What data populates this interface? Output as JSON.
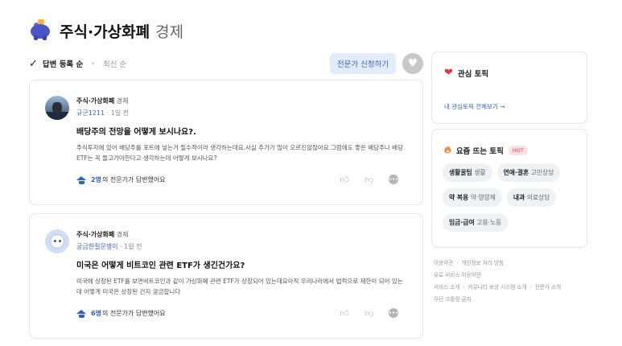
{
  "header": {
    "title_main": "주식·가상화폐",
    "title_sub": "경제",
    "icon": "piggy-bank-icon"
  },
  "sortbar": {
    "active_label": "답변 등록 순",
    "inactive_label": "최신 순",
    "expert_button": "전문가 신청하기"
  },
  "questions": [
    {
      "category": "주식·가상화폐",
      "category_sub": "경제",
      "user": "규군1211",
      "time": "1일 전",
      "title": "배당주의 전망을 어떻게 보시나요?.",
      "body": "주식투자에 있어 배당주를 포트에 넣는거 필수적이라 생각하는데요.사실 주가가 많이 오르진않잖아요.그럼에도 좋은 배당주나 배당ETF는 꼭 들고가야한다고 생각하는데 어떻게 보시나요?",
      "answer_count": "2명",
      "answer_text": "의 전문가가 답변했어요"
    },
    {
      "category": "주식·가상화폐",
      "category_sub": "경제",
      "user": "궁금한질문쟁이",
      "time": "1일 전",
      "title": "미국은 어떻게 비트코인 관련 ETF가 생긴건가요?",
      "body": "미국에 상장된 ETF를 보면비트코인과 같이 가상화폐 관련 ETF가 상장되어 있는데요아직 우리나라에서 법적으로 제한이 되어 있는데 어떻게 미국은 상장된 건지 궁금합니다",
      "answer_count": "6명",
      "answer_text": "의 전문가가 답변했어요"
    }
  ],
  "interest_box": {
    "title": "관심 토픽",
    "link": "내 관심토픽 전체보기 →"
  },
  "trending_box": {
    "title": "요즘 뜨는 토픽",
    "badge": "HOT",
    "chips": [
      {
        "main": "생활꿀팁",
        "sub": "생활"
      },
      {
        "main": "연애·결혼",
        "sub": "고민상담"
      },
      {
        "main": "약 복용",
        "sub": "약·영양제"
      },
      {
        "main": "내과",
        "sub": "의료상담"
      },
      {
        "main": "임금·급여",
        "sub": "고용·노동"
      }
    ]
  },
  "footer": {
    "terms": "이용약관",
    "privacy": "개인정보 처리 방침",
    "paid_terms": "유료 서비스 이용약관",
    "service_intro": "서비스 소개",
    "reward": "커뮤니티 보상 시스템 소개",
    "expert_intro": "전문가 소개",
    "crawling": "무단 크롤링 금지"
  },
  "colors": {
    "accent": "#3564c8",
    "hot": "#e0354b",
    "chip_bg": "#f0f1f4"
  }
}
